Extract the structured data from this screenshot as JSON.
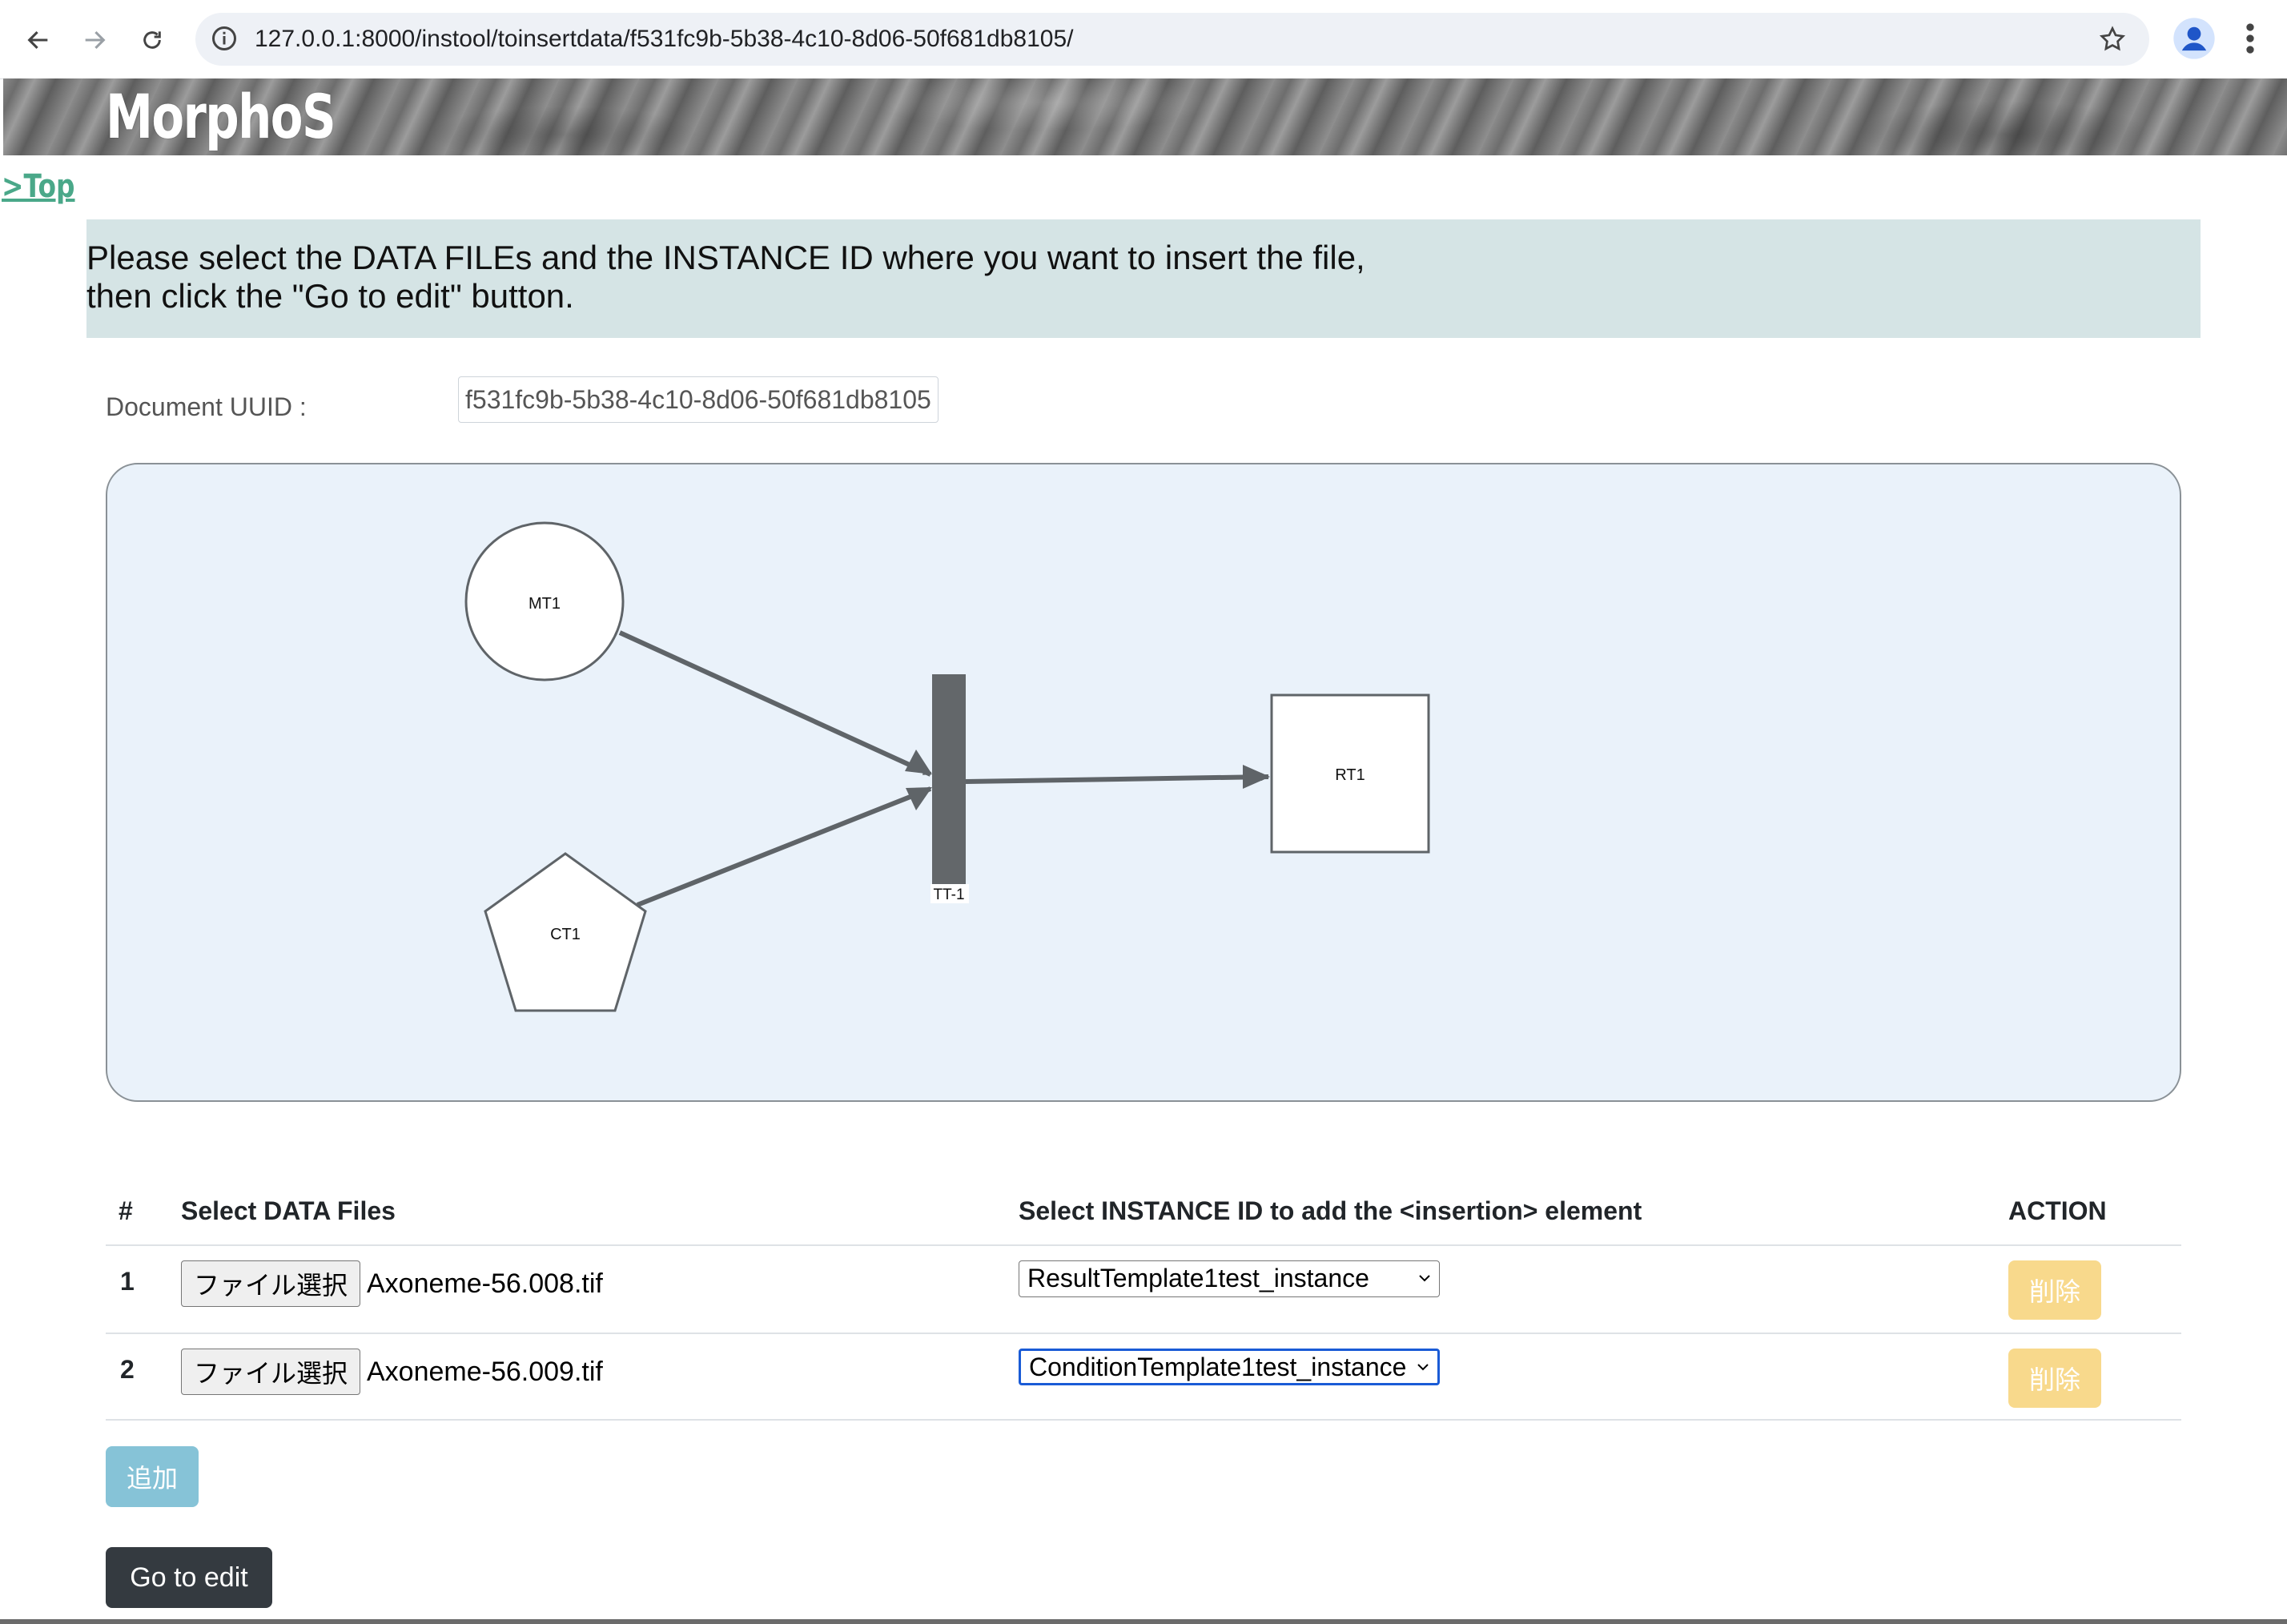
{
  "browser": {
    "url": "127.0.0.1:8000/instool/toinsertdata/f531fc9b-5b38-4c10-8d06-50f681db8105/",
    "icons": [
      "back-arrow-icon",
      "forward-arrow-icon",
      "reload-icon",
      "site-info-icon",
      "bookmark-star-icon",
      "profile-icon",
      "more-vert-icon"
    ]
  },
  "header": {
    "logo": "MorphoS"
  },
  "nav": {
    "top_link": ">Top"
  },
  "instructions": {
    "line1": "Please select the DATA FILEs and the INSTANCE ID where you want to insert the file,",
    "line2": "then click the \"Go to edit\" button."
  },
  "document": {
    "uuid_label": "Document UUID :",
    "uuid_value": "f531fc9b-5b38-4c10-8d06-50f681db8105"
  },
  "diagram": {
    "nodes": [
      {
        "id": "MT1",
        "shape": "circle",
        "label": "MT1"
      },
      {
        "id": "CT1",
        "shape": "pentagon",
        "label": "CT1"
      },
      {
        "id": "TT-1",
        "shape": "bar",
        "label": "TT-1"
      },
      {
        "id": "RT1",
        "shape": "square",
        "label": "RT1"
      }
    ],
    "edges": [
      {
        "from": "MT1",
        "to": "TT-1"
      },
      {
        "from": "CT1",
        "to": "TT-1"
      },
      {
        "from": "TT-1",
        "to": "RT1"
      }
    ],
    "colors": {
      "background": "#eaf2fa",
      "edge": "#5f6468",
      "bar": "#63676a"
    }
  },
  "table": {
    "headers": {
      "num": "#",
      "files": "Select DATA Files",
      "instance": "Select INSTANCE ID to add the <insertion> element",
      "action": "ACTION"
    },
    "rows": [
      {
        "num": "1",
        "file_button": "ファイル選択",
        "file_name": "Axoneme-56.008.tif",
        "instance": "ResultTemplate1test_instance",
        "delete": "削除"
      },
      {
        "num": "2",
        "file_button": "ファイル選択",
        "file_name": "Axoneme-56.009.tif",
        "instance": "ConditionTemplate1test_instance",
        "delete": "削除"
      }
    ]
  },
  "actions": {
    "add": "追加",
    "go_to_edit": "Go to edit"
  }
}
